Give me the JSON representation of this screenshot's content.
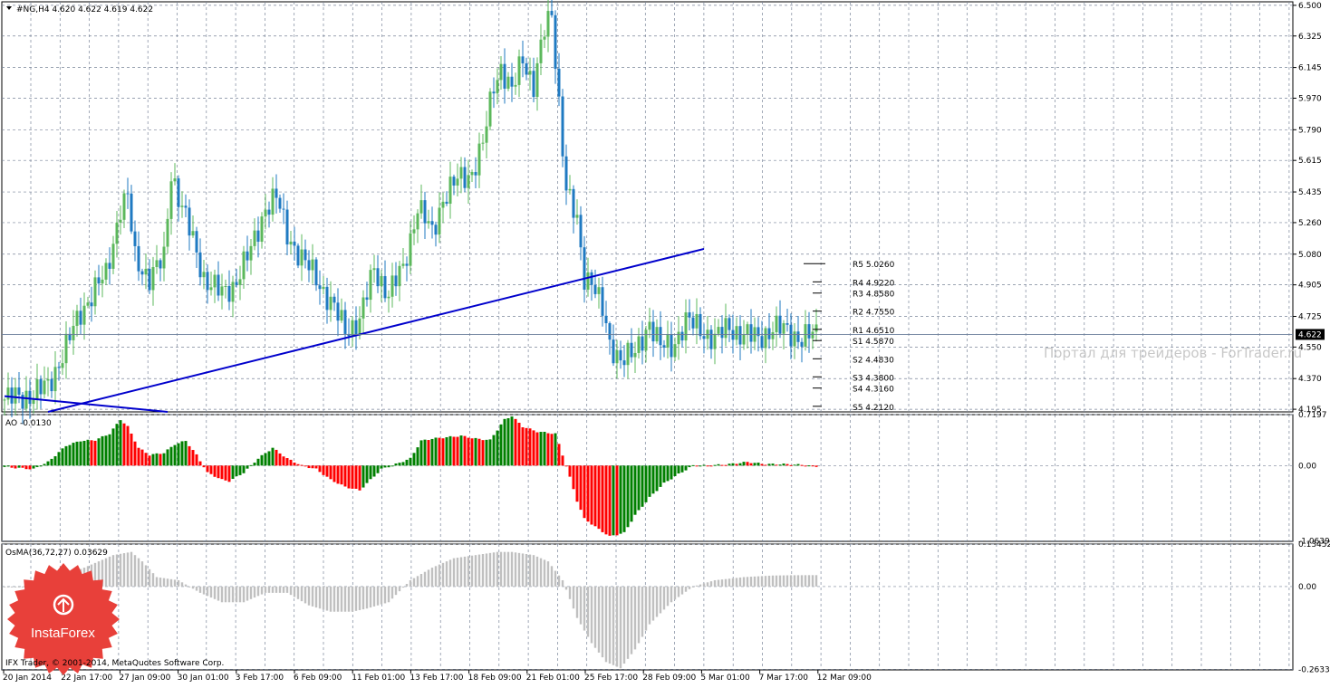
{
  "window": {
    "symbol_header": "#NG,H4  4.620 4.622 4.619 4.622",
    "current_price_label": "4.622",
    "watermark": "Портал для трейдеров - ForTrader.ru",
    "logo_text": "InstaForex",
    "copyright": "IFX Trader, © 2001-2014, MetaQuotes Software Corp.",
    "colors": {
      "bull": "#5cb85c",
      "bear": "#1f7ac2",
      "ao_up": "#008000",
      "ao_down": "#ff0000",
      "osma": "#c0c0c0",
      "trendline": "#0000cc",
      "grid": "#7a8599",
      "logo": "#e8403a"
    }
  },
  "x_axis": {
    "labels": [
      "20 Jan 2014",
      "22 Jan 17:00",
      "27 Jan 09:00",
      "30 Jan 01:00",
      "3 Feb 17:00",
      "6 Feb 09:00",
      "11 Feb 01:00",
      "13 Feb 17:00",
      "18 Feb 09:00",
      "21 Feb 01:00",
      "25 Feb 17:00",
      "28 Feb 09:00",
      "5 Mar 01:00",
      "7 Mar 17:00",
      "12 Mar 09:00"
    ]
  },
  "pivots": [
    {
      "label": "R5",
      "value": "5.0260"
    },
    {
      "label": "R4",
      "value": "4.9220"
    },
    {
      "label": "R3",
      "value": "4.8580"
    },
    {
      "label": "R2",
      "value": "4.7550"
    },
    {
      "label": "R1",
      "value": "4.6510"
    },
    {
      "label": "S1",
      "value": "4.5870"
    },
    {
      "label": "S2",
      "value": "4.4830"
    },
    {
      "label": "S3",
      "value": "4.3800"
    },
    {
      "label": "S4",
      "value": "4.3160"
    },
    {
      "label": "S5",
      "value": "4.2120"
    }
  ],
  "chart_data": [
    {
      "type": "candlestick",
      "title": "#NG,H4",
      "yticks": [
        "6.500",
        "6.325",
        "6.145",
        "5.970",
        "5.790",
        "5.615",
        "5.435",
        "5.260",
        "5.080",
        "4.905",
        "4.725",
        "4.550",
        "4.370",
        "4.195"
      ],
      "ylim": [
        4.18,
        6.52
      ],
      "last_price": 4.622,
      "trendlines": [
        {
          "x": [
            0,
            45
          ],
          "y": [
            4.27,
            4.18
          ]
        },
        {
          "x": [
            12,
            193
          ],
          "y": [
            4.18,
            5.11
          ]
        }
      ],
      "series": [
        {
          "anchors": [
            [
              0,
              4.25
            ],
            [
              8,
              4.28
            ],
            [
              12,
              4.33
            ],
            [
              17,
              4.55
            ],
            [
              21,
              4.75
            ],
            [
              25,
              4.88
            ],
            [
              28,
              4.96
            ],
            [
              32,
              5.35
            ],
            [
              34,
              5.4
            ],
            [
              36,
              5.05
            ],
            [
              40,
              4.95
            ],
            [
              44,
              5.05
            ],
            [
              46,
              5.55
            ],
            [
              49,
              5.35
            ],
            [
              52,
              5.15
            ],
            [
              55,
              4.95
            ],
            [
              60,
              4.85
            ],
            [
              63,
              4.9
            ],
            [
              68,
              5.1
            ],
            [
              72,
              5.35
            ],
            [
              75,
              5.4
            ],
            [
              78,
              5.2
            ],
            [
              82,
              5.05
            ],
            [
              86,
              4.95
            ],
            [
              90,
              4.8
            ],
            [
              94,
              4.65
            ],
            [
              98,
              4.7
            ],
            [
              102,
              5.0
            ],
            [
              106,
              4.85
            ],
            [
              110,
              5.0
            ],
            [
              114,
              5.35
            ],
            [
              118,
              5.2
            ],
            [
              121,
              5.4
            ],
            [
              125,
              5.5
            ],
            [
              129,
              5.55
            ],
            [
              132,
              5.7
            ],
            [
              135,
              6.05
            ],
            [
              137,
              6.15
            ],
            [
              140,
              6.0
            ],
            [
              143,
              6.2
            ],
            [
              146,
              6.05
            ],
            [
              149,
              6.35
            ],
            [
              151,
              6.45
            ],
            [
              153,
              5.95
            ],
            [
              155,
              5.45
            ],
            [
              158,
              5.25
            ],
            [
              160,
              4.95
            ],
            [
              162,
              4.95
            ],
            [
              165,
              4.75
            ],
            [
              167,
              4.55
            ],
            [
              170,
              4.5
            ],
            [
              174,
              4.5
            ],
            [
              178,
              4.7
            ],
            [
              181,
              4.55
            ],
            [
              184,
              4.55
            ],
            [
              188,
              4.7
            ],
            [
              192,
              4.65
            ],
            [
              196,
              4.6
            ],
            [
              200,
              4.66
            ],
            [
              204,
              4.62
            ],
            [
              208,
              4.6
            ],
            [
              212,
              4.66
            ],
            [
              216,
              4.64
            ],
            [
              220,
              4.6
            ],
            [
              224,
              4.622
            ]
          ]
        }
      ]
    },
    {
      "type": "bar",
      "title": "AO -0.0130",
      "yticks": [
        "0.7197",
        "0.00",
        "-1.0639"
      ],
      "ylim": [
        -1.07,
        0.72
      ],
      "series": [
        {
          "name": "AO",
          "anchors": [
            [
              0,
              -0.02
            ],
            [
              8,
              -0.05
            ],
            [
              12,
              0.05
            ],
            [
              17,
              0.28
            ],
            [
              21,
              0.35
            ],
            [
              25,
              0.36
            ],
            [
              29,
              0.45
            ],
            [
              32,
              0.65
            ],
            [
              34,
              0.55
            ],
            [
              37,
              0.25
            ],
            [
              40,
              0.15
            ],
            [
              44,
              0.18
            ],
            [
              47,
              0.3
            ],
            [
              50,
              0.35
            ],
            [
              53,
              0.15
            ],
            [
              56,
              -0.1
            ],
            [
              60,
              -0.2
            ],
            [
              62,
              -0.22
            ],
            [
              66,
              -0.1
            ],
            [
              70,
              0.1
            ],
            [
              74,
              0.25
            ],
            [
              78,
              0.1
            ],
            [
              82,
              0.0
            ],
            [
              86,
              -0.05
            ],
            [
              90,
              -0.2
            ],
            [
              94,
              -0.3
            ],
            [
              98,
              -0.35
            ],
            [
              101,
              -0.2
            ],
            [
              104,
              -0.05
            ],
            [
              108,
              0.02
            ],
            [
              112,
              0.1
            ],
            [
              115,
              0.35
            ],
            [
              118,
              0.38
            ],
            [
              122,
              0.4
            ],
            [
              126,
              0.42
            ],
            [
              130,
              0.38
            ],
            [
              134,
              0.36
            ],
            [
              138,
              0.65
            ],
            [
              140,
              0.7
            ],
            [
              143,
              0.55
            ],
            [
              147,
              0.48
            ],
            [
              152,
              0.45
            ],
            [
              155,
              0.0
            ],
            [
              158,
              -0.5
            ],
            [
              160,
              -0.75
            ],
            [
              164,
              -0.9
            ],
            [
              167,
              -1.0
            ],
            [
              171,
              -0.95
            ],
            [
              174,
              -0.7
            ],
            [
              178,
              -0.45
            ],
            [
              182,
              -0.25
            ],
            [
              186,
              -0.12
            ],
            [
              190,
              0.0
            ],
            [
              194,
              0.0
            ],
            [
              200,
              0.02
            ],
            [
              205,
              0.05
            ],
            [
              210,
              0.02
            ],
            [
              215,
              0.02
            ],
            [
              220,
              0.01
            ],
            [
              224,
              -0.013
            ]
          ]
        }
      ]
    },
    {
      "type": "bar",
      "title": "OsMA(36,72,27) 0.03629",
      "yticks": [
        "0.13452",
        "0.00",
        "-0.2633"
      ],
      "ylim": [
        -0.265,
        0.135
      ],
      "series": [
        {
          "name": "OsMA",
          "anchors": [
            [
              0,
              0.0
            ],
            [
              8,
              0.0
            ],
            [
              15,
              0.03
            ],
            [
              22,
              0.06
            ],
            [
              30,
              0.1
            ],
            [
              35,
              0.11
            ],
            [
              38,
              0.08
            ],
            [
              42,
              0.03
            ],
            [
              48,
              0.02
            ],
            [
              54,
              -0.02
            ],
            [
              60,
              -0.05
            ],
            [
              66,
              -0.05
            ],
            [
              72,
              -0.02
            ],
            [
              78,
              -0.02
            ],
            [
              84,
              -0.06
            ],
            [
              90,
              -0.08
            ],
            [
              96,
              -0.08
            ],
            [
              100,
              -0.07
            ],
            [
              106,
              -0.05
            ],
            [
              112,
              0.02
            ],
            [
              118,
              0.06
            ],
            [
              124,
              0.09
            ],
            [
              130,
              0.1
            ],
            [
              136,
              0.11
            ],
            [
              140,
              0.11
            ],
            [
              146,
              0.1
            ],
            [
              150,
              0.08
            ],
            [
              154,
              0.02
            ],
            [
              158,
              -0.1
            ],
            [
              162,
              -0.18
            ],
            [
              166,
              -0.24
            ],
            [
              170,
              -0.26
            ],
            [
              174,
              -0.2
            ],
            [
              178,
              -0.12
            ],
            [
              184,
              -0.05
            ],
            [
              190,
              0.0
            ],
            [
              196,
              0.02
            ],
            [
              204,
              0.03
            ],
            [
              212,
              0.035
            ],
            [
              218,
              0.036
            ],
            [
              224,
              0.03629
            ]
          ]
        }
      ]
    }
  ]
}
